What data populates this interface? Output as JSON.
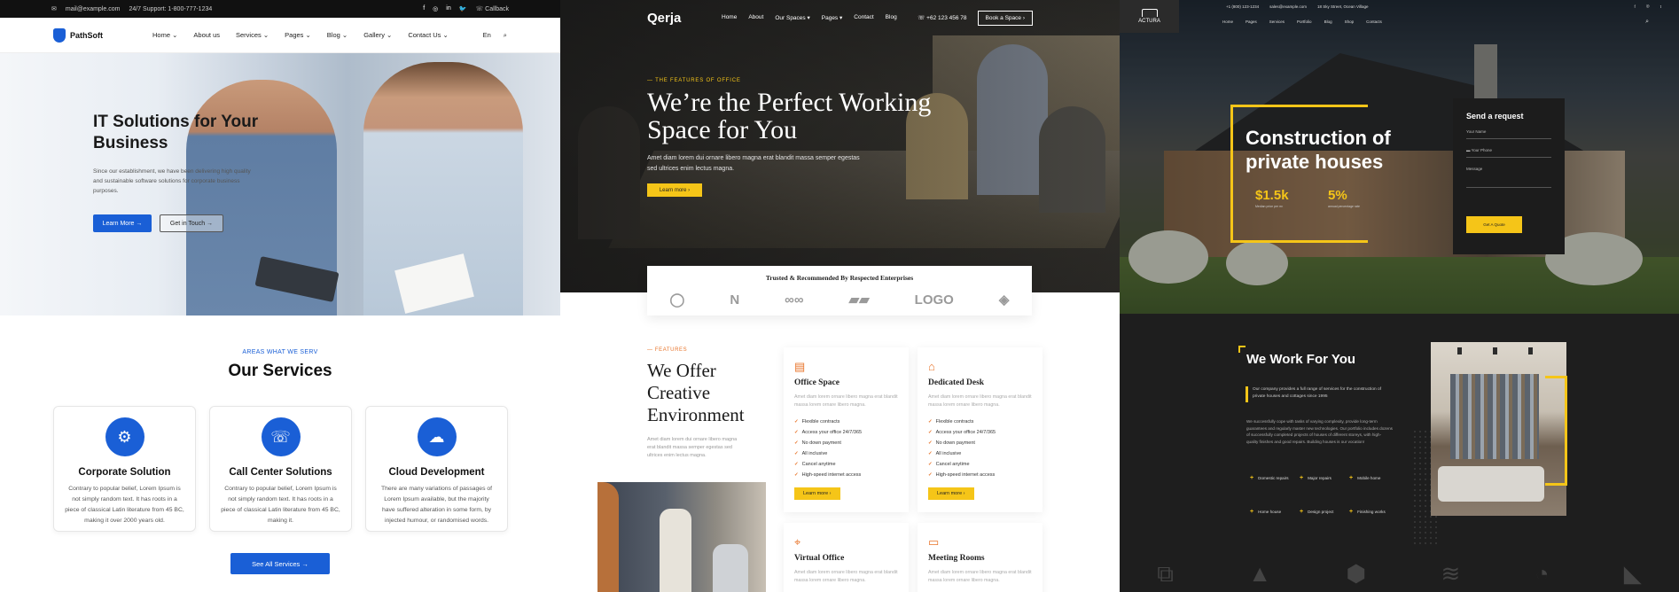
{
  "p1": {
    "topbar": {
      "email": "mail@example.com",
      "support": "24/7 Support: 1-800-777-1234",
      "callback": "Callback",
      "social_icons": [
        "facebook-icon",
        "instagram-icon",
        "linkedin-icon",
        "twitter-icon"
      ]
    },
    "logo": "PathSoft",
    "nav": [
      "Home",
      "About us",
      "Services",
      "Pages",
      "Blog",
      "Gallery",
      "Contact Us"
    ],
    "nav_dropdown": [
      true,
      false,
      true,
      true,
      true,
      true,
      true
    ],
    "lang": "En",
    "hero": {
      "title": "IT Solutions for Your Business",
      "desc": "Since our establishment, we have been delivering high quality and sustainable software solutions for corporate business purposes.",
      "btn_primary": "Learn More",
      "btn_secondary": "Get in Touch"
    },
    "services": {
      "kicker": "AREAS WHAT WE SERV",
      "title": "Our Services",
      "cards": [
        {
          "title": "Corporate Solution",
          "icon": "gear-icon",
          "desc": "Contrary to popular belief, Lorem Ipsum is not simply random text. It has roots in a piece of classical Latin literature from 45 BC, making it over 2000 years old."
        },
        {
          "title": "Call Center Solutions",
          "icon": "phone-icon",
          "desc": "Contrary to popular belief, Lorem Ipsum is not simply random text. It has roots in a piece of classical Latin literature from 45 BC, making it."
        },
        {
          "title": "Cloud Development",
          "icon": "cloud-upload-icon",
          "desc": "There are many variations of passages of Lorem Ipsum available, but the majority have suffered alteration in some form, by injected humour, or randomised words."
        }
      ],
      "all_btn": "See All Services"
    },
    "accent": "#1a5fd6"
  },
  "p2": {
    "logo": "Qerja",
    "nav": [
      "Home",
      "About",
      "Our Spaces",
      "Pages",
      "Contact",
      "Blog"
    ],
    "nav_dropdown": [
      false,
      false,
      true,
      true,
      false,
      false
    ],
    "phone": "+62 123 456 78",
    "book_btn": "Book a Space",
    "hero": {
      "kicker": "THE FEATURES OF OFFICE",
      "title": "We’re the Perfect Working Space for You",
      "desc": "Amet diam lorem dui ornare libero magna erat blandit massa semper egestas sed ultrices enim lectus magna.",
      "btn": "Learn more"
    },
    "trust": {
      "title": "Trusted & Recommended By Respected Enterprises",
      "logos": [
        "◯",
        "N",
        "∞∞",
        "▰▰",
        "LOGO",
        "◈"
      ]
    },
    "features": {
      "kicker": "FEATURES",
      "title": "We Offer Creative Environment",
      "desc": "Amet diam lorem dui ornare libero magna erat blandit massa semper egestas sed ultrices enim lectus magna.",
      "cards": [
        {
          "title": "Office Space",
          "icon": "building-icon",
          "desc": "Amet diam lorem ornare libero magna erat blandit massa lorem ornare libero magna.",
          "items": [
            "Flexible contracts",
            "Access your office 24/7/365",
            "No down payment",
            "All inclusive",
            "Cancel anytime",
            "High-speed internet access"
          ],
          "btn": "Learn more"
        },
        {
          "title": "Dedicated Desk",
          "icon": "desk-icon",
          "desc": "Amet diam lorem ornare libero magna erat blandit massa lorem ornare libero magna.",
          "items": [
            "Flexible contracts",
            "Access your office 24/7/365",
            "No down payment",
            "All inclusive",
            "Cancel anytime",
            "High-speed internet access"
          ],
          "btn": "Learn more"
        },
        {
          "title": "Virtual Office",
          "icon": "location-pin-icon",
          "desc": "Amet diam lorem ornare libero magna erat blandit massa lorem ornare libero magna."
        },
        {
          "title": "Meeting Rooms",
          "icon": "screen-icon",
          "desc": "Amet diam lorem ornare libero magna erat blandit massa lorem ornare libero magna."
        }
      ]
    },
    "accent_yellow": "#f5c518",
    "accent_orange": "#e8742a"
  },
  "p3": {
    "logo": "ACTURA",
    "topbar": [
      "+1 (800) 123-1234",
      "sales@example.com",
      "18 Sky Street, Ocean Village"
    ],
    "nav": [
      "Home",
      "Pages",
      "Services",
      "Portfolio",
      "Blog",
      "Shop",
      "Contacts"
    ],
    "hero": {
      "title": "Construction of private houses",
      "stats": [
        {
          "value": "$1.5k",
          "label": "Median price per m²"
        },
        {
          "value": "5%",
          "label": "annual percentage rate"
        }
      ]
    },
    "form": {
      "title": "Send a request",
      "name": "Your Name",
      "phone": "Your Phone",
      "message": "Message",
      "btn": "Get A Quote"
    },
    "work": {
      "title": "We Work For You",
      "intro": "Our company provides a full range of services for the construction of private houses and cottages since 1995",
      "body": "We successfully cope with tasks of varying complexity, provide long-term guarantees and regularly master new technologies. Our portfolio includes dozens of successfully completed projects of houses of different storeys, with high-quality finishes and good repairs. Building houses is our vocation!",
      "services": [
        "Domestic repairs",
        "Major repairs",
        "Mobile home",
        "Home house",
        "Design project",
        "Finishing works"
      ]
    },
    "accent": "#f5c518"
  }
}
